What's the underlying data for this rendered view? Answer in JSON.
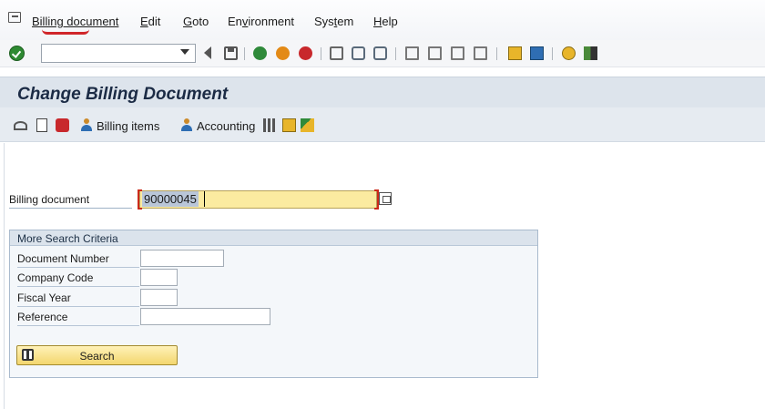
{
  "menu": {
    "items": [
      {
        "label": "Billing document",
        "u": "B",
        "rest": "illing document"
      },
      {
        "label": "Edit",
        "u": "E",
        "rest": "dit"
      },
      {
        "label": "Goto",
        "u": "G",
        "rest": "oto"
      },
      {
        "label": "Environment",
        "pre": "En",
        "u": "v",
        "rest": "ironment"
      },
      {
        "label": "System",
        "pre": "Sys",
        "u": "t",
        "rest": "em"
      },
      {
        "label": "Help",
        "u": "H",
        "rest": "elp"
      }
    ]
  },
  "toolbar": {
    "command_value": "",
    "icons": [
      "enter-icon",
      "back-icon",
      "save-icon",
      "back-green-icon",
      "exit-icon",
      "cancel-icon",
      "print-icon",
      "find-icon",
      "find-next-icon",
      "first-page-icon",
      "previous-page-icon",
      "next-page-icon",
      "last-page-icon",
      "create-session-icon",
      "shortcut-icon",
      "help-icon",
      "layout-icon"
    ]
  },
  "title": "Change Billing Document",
  "app_toolbar": {
    "billing_items": "Billing items",
    "accounting": "Accounting"
  },
  "form": {
    "billing_document_label": "Billing document",
    "billing_document_value": "90000045"
  },
  "search_group": {
    "title": "More Search Criteria",
    "fields": {
      "document_number": {
        "label": "Document Number",
        "value": ""
      },
      "company_code": {
        "label": "Company Code",
        "value": ""
      },
      "fiscal_year": {
        "label": "Fiscal Year",
        "value": ""
      },
      "reference": {
        "label": "Reference",
        "value": ""
      }
    },
    "search_label": "Search"
  },
  "colors": {
    "title_bar": "#dde4ec",
    "input_highlight": "#fbeba0",
    "annotation_red": "#d0262a"
  }
}
